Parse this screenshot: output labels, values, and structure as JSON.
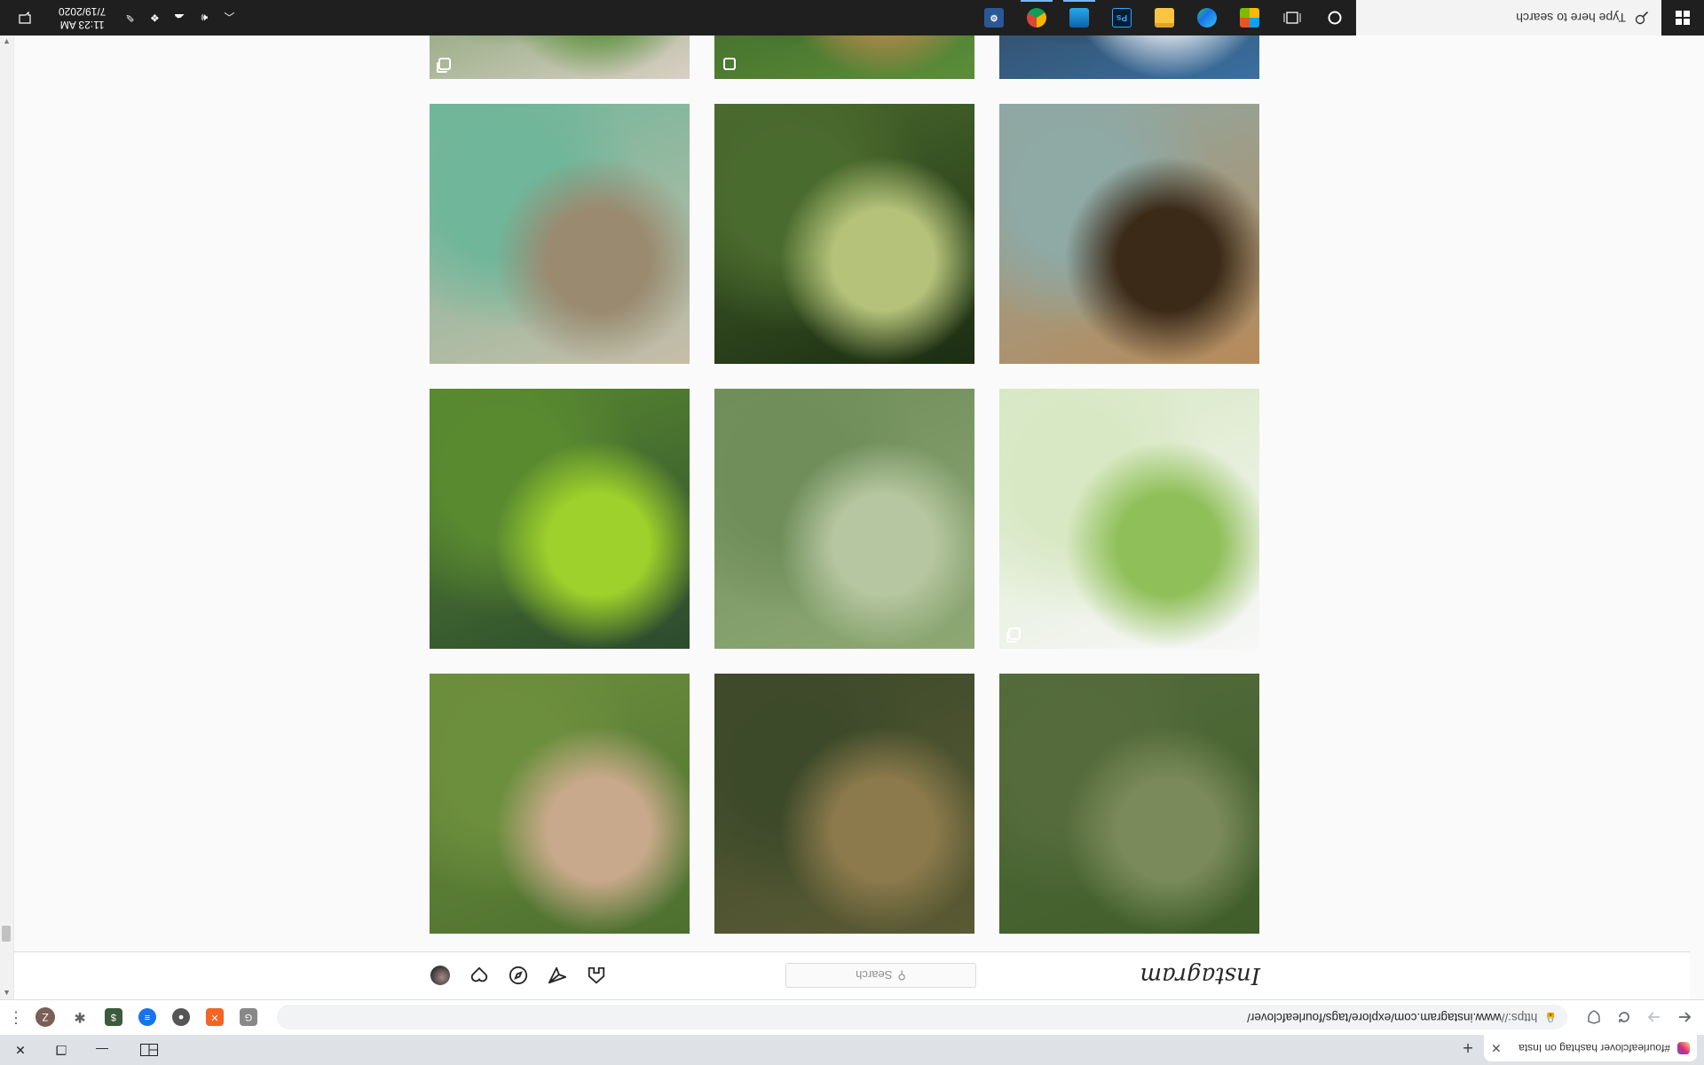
{
  "browser": {
    "tab_title": "#fourleafclover hashtag on Insta",
    "new_tab_symbol": "+",
    "close_symbol": "✕",
    "url_scheme": "https://",
    "url_rest": "www.instagram.com/explore/tags/fourleafclover/",
    "profile_initial": "Z",
    "window_controls": {
      "minimize": "—",
      "restore": "❐",
      "close": "✕"
    }
  },
  "instagram": {
    "logo_text": "Instagram",
    "search_placeholder": "Search"
  },
  "posts": [
    {
      "colors": [
        "#3f5e2a",
        "#7a8a5a",
        "#556b3b"
      ]
    },
    {
      "colors": [
        "#5a5a34",
        "#8c7a4c",
        "#3d4a2a"
      ]
    },
    {
      "colors": [
        "#4d7030",
        "#c9a98b",
        "#6c8f3d"
      ]
    },
    {
      "colors": [
        "#f7f7f7",
        "#8fbf58",
        "#d8e8c4"
      ],
      "badge": "carousel"
    },
    {
      "colors": [
        "#8ea874",
        "#b6c6a0",
        "#6f8e5a"
      ]
    },
    {
      "colors": [
        "#2c4a2e",
        "#9ed12b",
        "#5a8a30"
      ]
    },
    {
      "colors": [
        "#b68a5a",
        "#3b2a18",
        "#8fa9a5"
      ]
    },
    {
      "colors": [
        "#1c2d12",
        "#b5c27a",
        "#4a6b2e"
      ]
    },
    {
      "colors": [
        "#c7bda8",
        "#9a8a70",
        "#6fb69a"
      ]
    },
    {
      "colors": [
        "#3a6fa0",
        "#e8eff6",
        "#2a2a2a"
      ]
    },
    {
      "colors": [
        "#5b8e3a",
        "#b8894a",
        "#2b4a1c"
      ],
      "badge": "single"
    },
    {
      "colors": [
        "#d8d0c4",
        "#5a8f3a",
        "#3e7a30"
      ],
      "badge": "carousel"
    },
    {
      "colors": [
        "#5b7a3a",
        "#c0a070",
        "#3b2a18"
      ],
      "badge": "single"
    },
    {
      "colors": [
        "#4a4a2a",
        "#7a8a4a",
        "#2a3a1a"
      ]
    },
    {
      "colors": [
        "#6b8a4a",
        "#4a6a3a",
        "#9aa070"
      ]
    }
  ],
  "taskbar": {
    "search_placeholder": "Type here to search",
    "time": "11:23 AM",
    "date": "7/19/2020"
  }
}
